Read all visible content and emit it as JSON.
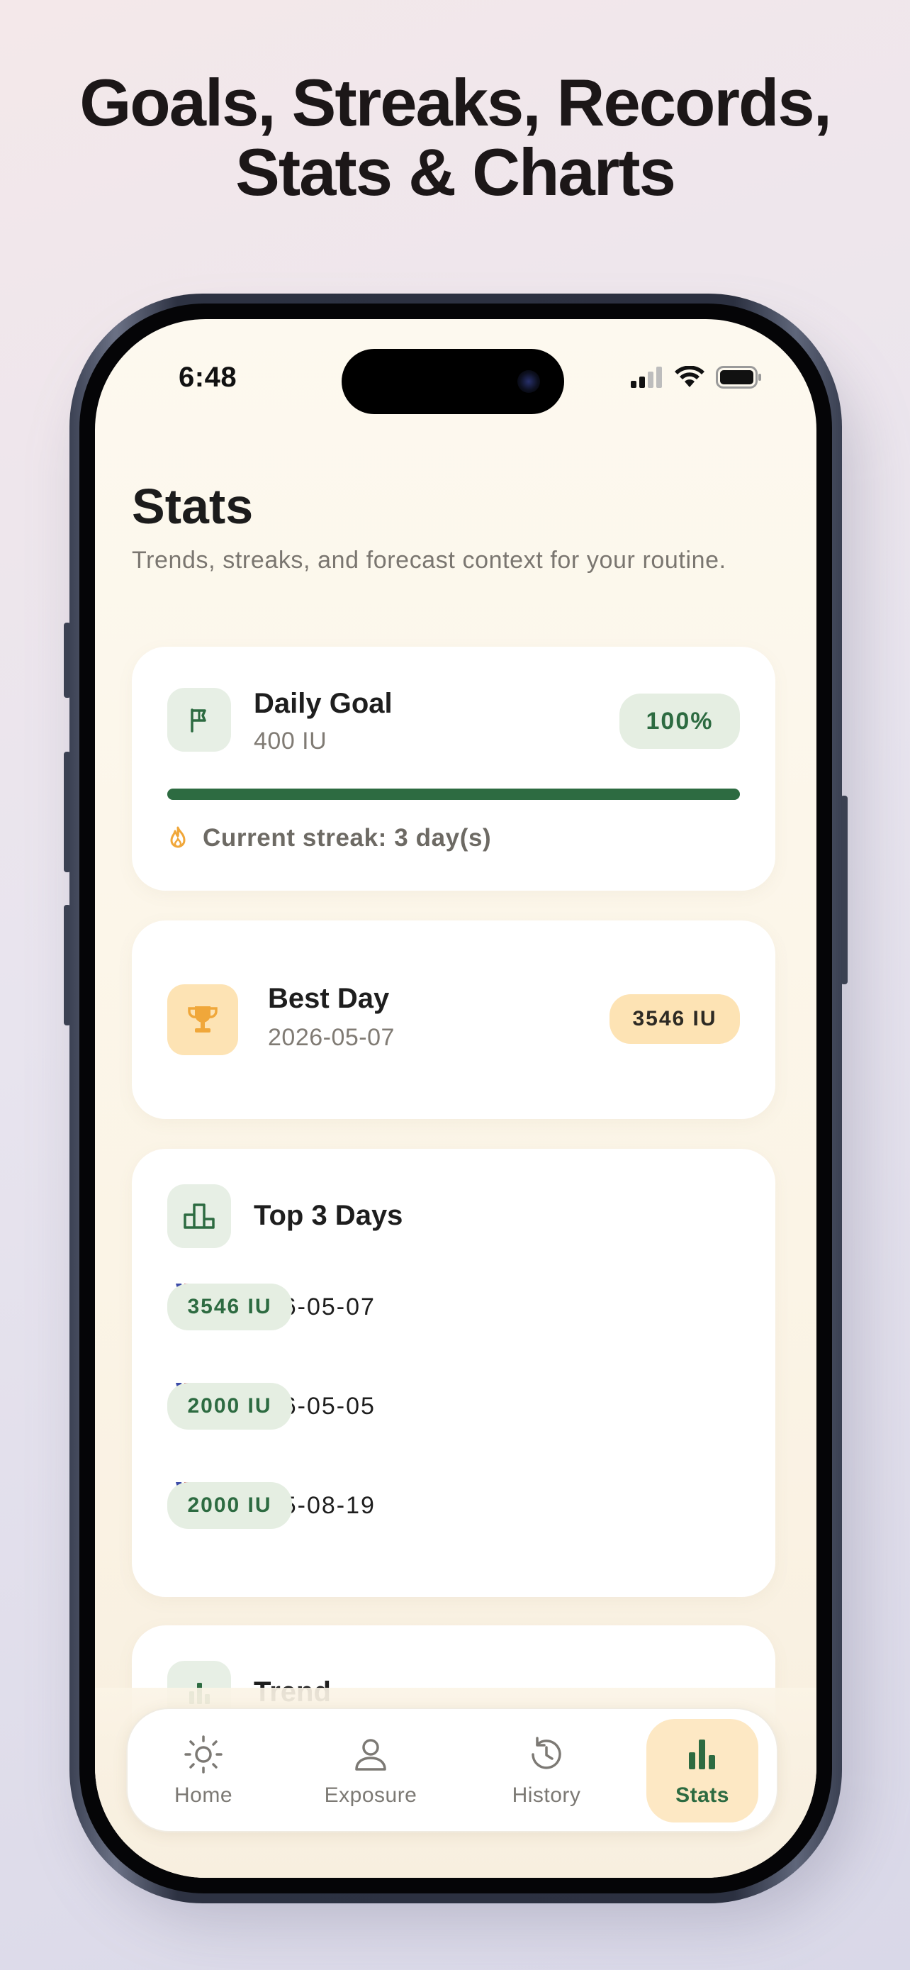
{
  "headline": {
    "line1": "Goals, Streaks, Records,",
    "line2": "Stats & Charts"
  },
  "status_bar": {
    "time": "6:48",
    "icons": [
      "cellular-signal-icon",
      "wifi-icon",
      "battery-icon"
    ]
  },
  "page": {
    "title": "Stats",
    "subtitle": "Trends, streaks, and forecast context for your routine."
  },
  "daily_goal": {
    "icon": "flag-icon",
    "title": "Daily Goal",
    "target": "400 IU",
    "percent_label": "100%",
    "progress": 1.0,
    "streak_icon": "flame-icon",
    "streak_text": "Current streak: 3 day(s)"
  },
  "best_day": {
    "icon": "trophy-icon",
    "title": "Best Day",
    "date": "2026-05-07",
    "value": "3546 IU"
  },
  "top_days": {
    "icon": "podium-icon",
    "title": "Top 3 Days",
    "rows": [
      {
        "rank": "1",
        "medal": "gold-medal-icon",
        "date": "2026-05-07",
        "value": "3546 IU"
      },
      {
        "rank": "2",
        "medal": "silver-medal-icon",
        "date": "2026-05-05",
        "value": "2000 IU"
      },
      {
        "rank": "3",
        "medal": "bronze-medal-icon",
        "date": "2025-08-19",
        "value": "2000 IU"
      }
    ]
  },
  "trend": {
    "icon": "bar-chart-icon",
    "title": "Trend"
  },
  "tabbar": {
    "tabs": [
      {
        "label": "Home",
        "icon": "sun-icon",
        "active": false
      },
      {
        "label": "Exposure",
        "icon": "person-icon",
        "active": false
      },
      {
        "label": "History",
        "icon": "history-icon",
        "active": false
      },
      {
        "label": "Stats",
        "icon": "bar-chart-icon",
        "active": true
      }
    ]
  },
  "colors": {
    "accent_green": "#2d6b41",
    "accent_amber": "#f0a73a",
    "tile_green": "#e7efe5",
    "tile_amber": "#fde3b4",
    "background": "#fdf9ef"
  }
}
